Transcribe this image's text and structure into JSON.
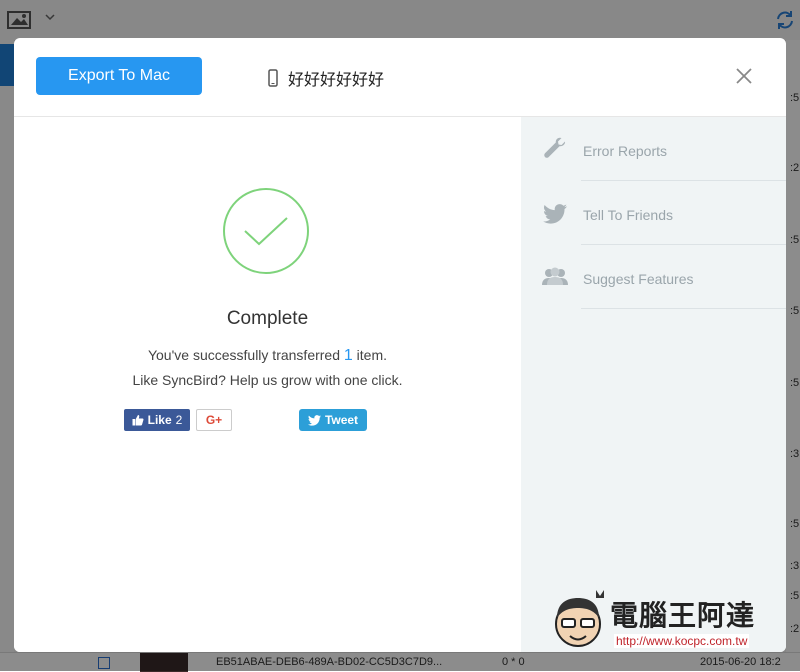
{
  "background": {
    "right_col_times": [
      ":5",
      ":2",
      ":5",
      ":5",
      ":5",
      ":3",
      ":5",
      ":3",
      ":5",
      ":2"
    ],
    "bottom_row": {
      "filename": "EB51ABAE-DEB6-489A-BD02-CC5D3C7D9...",
      "count": "0 * 0",
      "date": "2015-06-20 18:2"
    }
  },
  "modal": {
    "export_button_label": "Export To Mac",
    "device_name": "好好好好好好",
    "main": {
      "title": "Complete",
      "message_prefix": "You've successfully transferred ",
      "message_count": "1",
      "message_suffix": " item.",
      "message_line2": "Like SyncBird? Help us grow with one click.",
      "like_label": "Like",
      "like_count": "2",
      "gplus_label": "G+",
      "tweet_label": "Tweet"
    },
    "side_items": [
      {
        "label": "Error Reports",
        "icon": "wrench-icon"
      },
      {
        "label": "Tell To Friends",
        "icon": "twitter-bird-icon"
      },
      {
        "label": "Suggest Features",
        "icon": "users-icon"
      }
    ]
  },
  "watermark": {
    "title": "電腦王阿達",
    "url": "http://www.kocpc.com.tw"
  },
  "colors": {
    "accent": "#2797f1",
    "check_green": "#7ed37b",
    "facebook": "#3b5998",
    "twitter": "#2c9fd8",
    "side_bg": "#f0f4f5"
  }
}
